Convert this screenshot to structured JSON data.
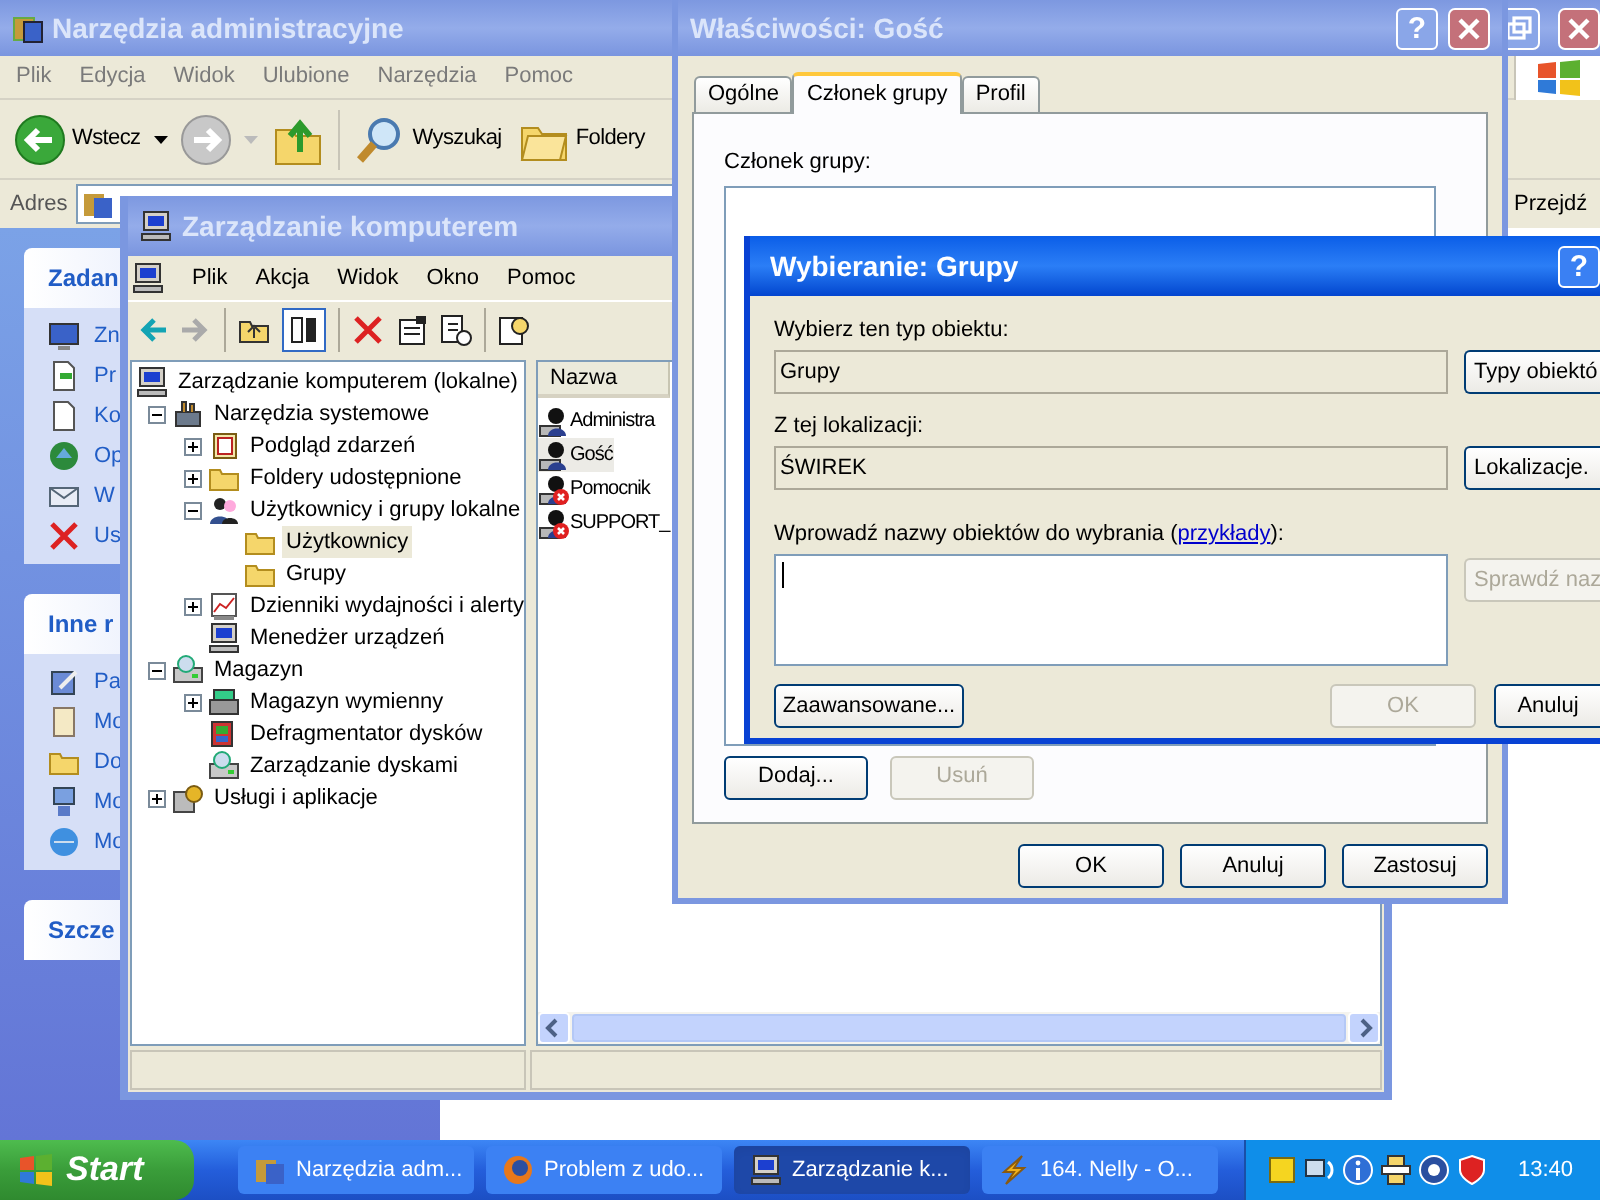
{
  "explorer": {
    "title": "Narzędzia administracyjne",
    "active": false,
    "menu": [
      "Plik",
      "Edycja",
      "Widok",
      "Ulubione",
      "Narzędzia",
      "Pomoc"
    ],
    "toolbar": [
      "Wstecz",
      "Wyszukaj",
      "Foldery"
    ],
    "address_label": "Adres",
    "go_button": "Przejdź",
    "task_panes": [
      {
        "title": "Zadan",
        "items": [
          "Zn",
          "Pr",
          "Ko",
          "Op",
          "W",
          "Us"
        ]
      },
      {
        "title": "Inne r",
        "items": [
          "Pa",
          "Mo",
          "Do",
          "Mo",
          "Mo"
        ]
      },
      {
        "title": "Szcze"
      }
    ]
  },
  "computer_management": {
    "title": "Zarządzanie komputerem",
    "active": false,
    "menu": [
      "Plik",
      "Akcja",
      "Widok",
      "Okno",
      "Pomoc"
    ],
    "tree": [
      {
        "label": "Zarządzanie komputerem (lokalne)",
        "selected": false,
        "children": [
          {
            "label": "Narzędzia systemowe",
            "expanded": true,
            "selected": false,
            "children": [
              {
                "label": "Podgląd zdarzeń",
                "expanded": false,
                "selected": false
              },
              {
                "label": "Foldery udostępnione",
                "expanded": false,
                "selected": false
              },
              {
                "label": "Użytkownicy i grupy lokalne",
                "expanded": true,
                "selected": false,
                "children": [
                  {
                    "label": "Użytkownicy",
                    "selected": true
                  },
                  {
                    "label": "Grupy",
                    "selected": false
                  }
                ]
              },
              {
                "label": "Dzienniki wydajności i alerty",
                "expanded": false,
                "selected": false
              },
              {
                "label": "Menedżer urządzeń",
                "selected": false
              }
            ]
          },
          {
            "label": "Magazyn",
            "expanded": true,
            "selected": false,
            "children": [
              {
                "label": "Magazyn wymienny",
                "expanded": false,
                "selected": false
              },
              {
                "label": "Defragmentator dysków",
                "selected": false
              },
              {
                "label": "Zarządzanie dyskami",
                "selected": false
              }
            ]
          },
          {
            "label": "Usługi i aplikacje",
            "expanded": false,
            "selected": false
          }
        ]
      }
    ],
    "list": {
      "columns": [
        "Nazwa"
      ],
      "rows": [
        {
          "name": "Administra",
          "selected": false,
          "disabled": false
        },
        {
          "name": "Gość",
          "selected": true,
          "disabled": false
        },
        {
          "name": "Pomocnik",
          "selected": false,
          "disabled": true
        },
        {
          "name": "SUPPORT_",
          "selected": false,
          "disabled": true
        }
      ]
    }
  },
  "properties": {
    "title": "Właściwości: Gość",
    "active": false,
    "help_button": "?",
    "tabs": [
      {
        "label": "Ogólne",
        "selected": false
      },
      {
        "label": "Członek grupy",
        "selected": true
      },
      {
        "label": "Profil",
        "selected": false
      }
    ],
    "member_label": "Członek grupy:",
    "buttons": [
      {
        "label": "Dodaj...",
        "disabled": false
      },
      {
        "label": "Usuń",
        "disabled": true
      }
    ],
    "footer_buttons": [
      "OK",
      "Anuluj",
      "Zastosuj"
    ]
  },
  "select_dialog": {
    "title": "Wybieranie: Grupy",
    "active": true,
    "help_button": "?",
    "object_type": {
      "label": "Wybierz ten typ obiektu:",
      "value": "Grupy",
      "button": "Typy obiektó"
    },
    "location": {
      "label": "Z tej lokalizacji:",
      "value": "ŚWIREK",
      "button": "Lokalizacje."
    },
    "names": {
      "label_before": "Wprowadź nazwy obiektów do wybrania (",
      "link": "przykłady",
      "label_after": "):",
      "check_button": {
        "label": "Sprawdź naz",
        "disabled": true
      }
    },
    "advanced_button": "Zaawansowane...",
    "ok_button": {
      "label": "OK",
      "disabled": true
    },
    "cancel_button": "Anuluj"
  },
  "taskbar": {
    "start": "Start",
    "tasks": [
      {
        "label": "Narzędzia adm...",
        "selected": false
      },
      {
        "label": "Problem z udo...",
        "selected": false
      },
      {
        "label": "Zarządzanie k...",
        "selected": true
      },
      {
        "label": "164. Nelly - O...",
        "selected": false
      }
    ],
    "clock": "13:40"
  }
}
